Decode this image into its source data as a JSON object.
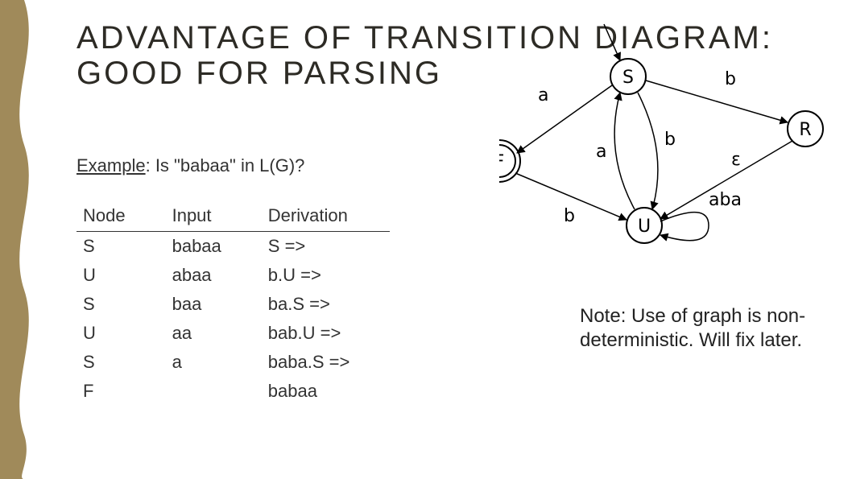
{
  "title": "ADVANTAGE OF TRANSITION DIAGRAM: GOOD FOR PARSING",
  "example_prefix": "Example",
  "example_rest": ": Is \"babaa\" in L(G)?",
  "table": {
    "headers": {
      "node": "Node",
      "input": "Input",
      "derivation": "Derivation"
    },
    "rows": [
      {
        "node": "S",
        "input": "babaa",
        "derivation": "S =>"
      },
      {
        "node": "U",
        "input": "abaa",
        "derivation": "b.U =>"
      },
      {
        "node": "S",
        "input": "baa",
        "derivation": "ba.S =>"
      },
      {
        "node": "U",
        "input": "aa",
        "derivation": "bab.U =>"
      },
      {
        "node": "S",
        "input": "a",
        "derivation": "baba.S =>"
      },
      {
        "node": "F",
        "input": "",
        "derivation": "babaa"
      }
    ]
  },
  "note": "Note: Use of graph is non-deterministic. Will fix later.",
  "diagram": {
    "nodes": {
      "S": "S",
      "F": "F",
      "U": "U",
      "R": "R"
    },
    "edges": {
      "S_F": "a",
      "S_R": "b",
      "S_U_down": "b",
      "U_S_up": "a",
      "R_U": "ε",
      "F_U": "b",
      "U_loop": "aba"
    }
  }
}
